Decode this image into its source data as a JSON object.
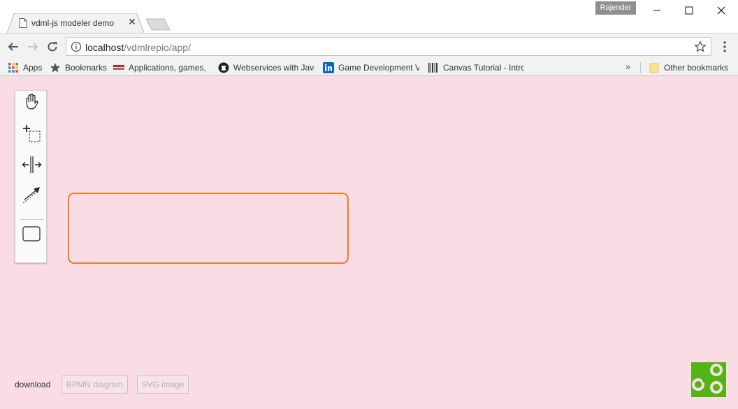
{
  "browser": {
    "tab": {
      "title": "vdml-js modeler demo"
    },
    "profile": {
      "name": "Rajender"
    },
    "address_bar": {
      "host": "localhost",
      "path": "/vdmlrepio/app/"
    },
    "bookmarks": [
      {
        "label": "Apps",
        "icon": "apps-grid-icon"
      },
      {
        "label": "Bookmarks",
        "icon": "star-icon"
      },
      {
        "label": "Applications, games, t",
        "icon": "site-favicon"
      },
      {
        "label": "Webservices with Java",
        "icon": "github-icon"
      },
      {
        "label": "Game Development V",
        "icon": "linkedin-icon"
      },
      {
        "label": "Canvas Tutorial - Intro",
        "icon": "barcode-icon"
      }
    ],
    "other_bookmarks": "Other bookmarks",
    "overflow_chevron": "»"
  },
  "modeler": {
    "palette": [
      {
        "name": "hand-tool",
        "icon": "hand-icon"
      },
      {
        "name": "lasso-tool",
        "icon": "lasso-icon"
      },
      {
        "name": "space-tool",
        "icon": "space-icon"
      },
      {
        "name": "connect-tool",
        "icon": "connect-arrow-icon"
      },
      {
        "name": "create-shape",
        "icon": "rounded-rect-icon"
      }
    ],
    "colors": {
      "canvas": "#fadde4",
      "selection": "#f07d1f",
      "logo": "#52b415"
    }
  },
  "footer": {
    "download_label": "download",
    "bpmn_button": "BPMN diagram",
    "svg_button": "SVG image"
  }
}
